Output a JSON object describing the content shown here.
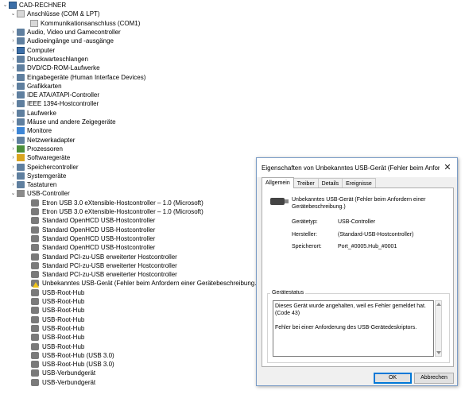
{
  "tree": {
    "items": [
      {
        "label": "CAD-RECHNER",
        "chevron": "v",
        "icon": "computer-icon",
        "level": 0
      },
      {
        "label": "Anschlüsse (COM & LPT)",
        "chevron": "v",
        "icon": "ports-icon",
        "level": 1
      },
      {
        "label": "Kommunikationsanschluss (COM1)",
        "chevron": "",
        "icon": "port-icon",
        "level": 2
      },
      {
        "label": "Audio, Video und Gamecontroller",
        "chevron": ">",
        "icon": "speaker-icon",
        "level": 1
      },
      {
        "label": "Audioeingänge und -ausgänge",
        "chevron": ">",
        "icon": "speaker-icon",
        "level": 1
      },
      {
        "label": "Computer",
        "chevron": ">",
        "icon": "computer-icon",
        "level": 1
      },
      {
        "label": "Druckwarteschlangen",
        "chevron": ">",
        "icon": "printer-icon",
        "level": 1
      },
      {
        "label": "DVD/CD-ROM-Laufwerke",
        "chevron": ">",
        "icon": "disc-icon",
        "level": 1
      },
      {
        "label": "Eingabegeräte (Human Interface Devices)",
        "chevron": ">",
        "icon": "hid-icon",
        "level": 1
      },
      {
        "label": "Grafikkarten",
        "chevron": ">",
        "icon": "display-adapter-icon",
        "level": 1
      },
      {
        "label": "IDE ATA/ATAPI-Controller",
        "chevron": ">",
        "icon": "ide-icon",
        "level": 1
      },
      {
        "label": "IEEE 1394-Hostcontroller",
        "chevron": ">",
        "icon": "firewire-icon",
        "level": 1
      },
      {
        "label": "Laufwerke",
        "chevron": ">",
        "icon": "drive-icon",
        "level": 1
      },
      {
        "label": "Mäuse und andere Zeigegeräte",
        "chevron": ">",
        "icon": "mouse-icon",
        "level": 1
      },
      {
        "label": "Monitore",
        "chevron": ">",
        "icon": "monitor-icon",
        "level": 1
      },
      {
        "label": "Netzwerkadapter",
        "chevron": ">",
        "icon": "network-icon",
        "level": 1
      },
      {
        "label": "Prozessoren",
        "chevron": ">",
        "icon": "cpu-icon",
        "level": 1
      },
      {
        "label": "Softwaregeräte",
        "chevron": ">",
        "icon": "software-device-icon",
        "level": 1
      },
      {
        "label": "Speichercontroller",
        "chevron": ">",
        "icon": "storage-icon",
        "level": 1
      },
      {
        "label": "Systemgeräte",
        "chevron": ">",
        "icon": "system-icon",
        "level": 1
      },
      {
        "label": "Tastaturen",
        "chevron": ">",
        "icon": "keyboard-icon",
        "level": 1
      },
      {
        "label": "USB-Controller",
        "chevron": "v",
        "icon": "usb-icon",
        "level": 1
      },
      {
        "label": "Etron USB 3.0 eXtensible-Hostcontroller – 1.0 (Microsoft)",
        "chevron": "",
        "icon": "usb-device-icon",
        "level": 2
      },
      {
        "label": "Etron USB 3.0 eXtensible-Hostcontroller – 1.0 (Microsoft)",
        "chevron": "",
        "icon": "usb-device-icon",
        "level": 2
      },
      {
        "label": "Standard OpenHCD USB-Hostcontroller",
        "chevron": "",
        "icon": "usb-device-icon",
        "level": 2
      },
      {
        "label": "Standard OpenHCD USB-Hostcontroller",
        "chevron": "",
        "icon": "usb-device-icon",
        "level": 2
      },
      {
        "label": "Standard OpenHCD USB-Hostcontroller",
        "chevron": "",
        "icon": "usb-device-icon",
        "level": 2
      },
      {
        "label": "Standard OpenHCD USB-Hostcontroller",
        "chevron": "",
        "icon": "usb-device-icon",
        "level": 2
      },
      {
        "label": "Standard PCI-zu-USB erweiterter Hostcontroller",
        "chevron": "",
        "icon": "usb-device-icon",
        "level": 2
      },
      {
        "label": "Standard PCI-zu-USB erweiterter Hostcontroller",
        "chevron": "",
        "icon": "usb-device-icon",
        "level": 2
      },
      {
        "label": "Standard PCI-zu-USB erweiterter Hostcontroller",
        "chevron": "",
        "icon": "usb-device-icon",
        "level": 2
      },
      {
        "label": "Unbekanntes USB-Gerät (Fehler beim Anfordern einer Gerätebeschreibung.)",
        "chevron": "",
        "icon": "usb-warning-icon",
        "level": 2
      },
      {
        "label": "USB-Root-Hub",
        "chevron": "",
        "icon": "usb-device-icon",
        "level": 2
      },
      {
        "label": "USB-Root-Hub",
        "chevron": "",
        "icon": "usb-device-icon",
        "level": 2
      },
      {
        "label": "USB-Root-Hub",
        "chevron": "",
        "icon": "usb-device-icon",
        "level": 2
      },
      {
        "label": "USB-Root-Hub",
        "chevron": "",
        "icon": "usb-device-icon",
        "level": 2
      },
      {
        "label": "USB-Root-Hub",
        "chevron": "",
        "icon": "usb-device-icon",
        "level": 2
      },
      {
        "label": "USB-Root-Hub",
        "chevron": "",
        "icon": "usb-device-icon",
        "level": 2
      },
      {
        "label": "USB-Root-Hub",
        "chevron": "",
        "icon": "usb-device-icon",
        "level": 2
      },
      {
        "label": "USB-Root-Hub (USB 3.0)",
        "chevron": "",
        "icon": "usb-device-icon",
        "level": 2
      },
      {
        "label": "USB-Root-Hub (USB 3.0)",
        "chevron": "",
        "icon": "usb-device-icon",
        "level": 2
      },
      {
        "label": "USB-Verbundgerät",
        "chevron": "",
        "icon": "usb-device-icon",
        "level": 2
      },
      {
        "label": "USB-Verbundgerät",
        "chevron": "",
        "icon": "usb-device-icon",
        "level": 2
      }
    ]
  },
  "dialog": {
    "title": "Eigenschaften von Unbekanntes USB-Gerät (Fehler beim Anforder...",
    "close_glyph": "✕",
    "tabs": [
      "Allgemein",
      "Treiber",
      "Details",
      "Ereignisse"
    ],
    "active_tab": "Allgemein",
    "device_name": "Unbekanntes USB-Gerät (Fehler beim Anfordern einer Gerätebeschreibung.)",
    "properties": [
      {
        "label": "Gerätetyp:",
        "value": "USB-Controller"
      },
      {
        "label": "Hersteller:",
        "value": "(Standard-USB-Hostcontroller)"
      },
      {
        "label": "Speicherort:",
        "value": "Port_#0005.Hub_#0001"
      }
    ],
    "status_group_title": "Gerätestatus",
    "status_line1": "Dieses Gerät wurde angehalten, weil es Fehler gemeldet hat. (Code 43)",
    "status_line2": "Fehler bei einer Anforderung des USB-Gerätedeskriptors.",
    "ok_label": "OK",
    "cancel_label": "Abbrechen"
  },
  "colors": {
    "accent": "#0078d7",
    "warning": "#f0c419"
  }
}
